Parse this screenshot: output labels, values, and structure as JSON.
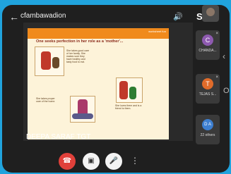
{
  "header": {
    "meeting_title": "cfambawadion",
    "back_icon": "arrow-left-icon",
    "speaker_icon": "volume-icon",
    "switch_camera_label": "S"
  },
  "slide": {
    "title": "One seeks perfection in her role as a 'mother'...",
    "tag": "worksheet fun",
    "caption_1": "She takes good care of her family. She makes sure they have healthy and tasty food to eat.",
    "caption_2": "She takes proper care of the home.",
    "caption_3": "She loves them and is a friend to them."
  },
  "presenter": {
    "name": "DEEPA SARAF TGT"
  },
  "participants": [
    {
      "initial": "C",
      "name": "CHANDA...",
      "color": "#8e5ab0"
    },
    {
      "initial": "T",
      "name": "TEJAS S...",
      "color": "#e06b2a"
    },
    {
      "initial": "D A",
      "name": "22 others",
      "color": "#3d7fd1"
    }
  ],
  "controls": {
    "end_call_icon": "phone-hangup-icon",
    "camera_off_icon": "camera-off-icon",
    "mic_off_icon": "mic-off-icon",
    "more_icon": "more-vertical-icon"
  }
}
